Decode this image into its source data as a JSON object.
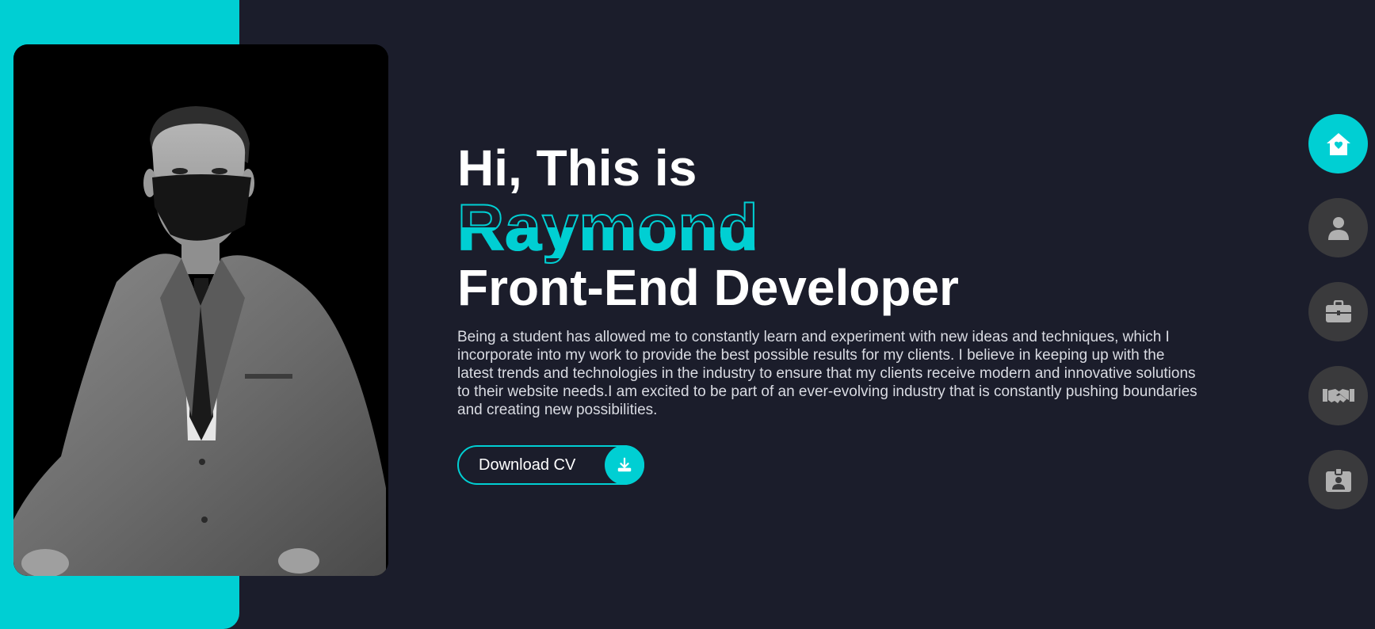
{
  "hero": {
    "greeting": "Hi, This is",
    "name": "Raymond",
    "role": "Front-End Developer",
    "bio": "Being a student has allowed me to constantly learn and experiment with new ideas and techniques, which I incorporate into my work to provide the best possible results for my clients. I believe in keeping up with the latest trends and technologies in the industry to ensure that my clients receive modern and innovative solutions to their website needs.I am excited to be part of an ever-evolving industry that is constantly pushing boundaries and creating new possibilities."
  },
  "cv_button": {
    "label": "Download CV",
    "icon": "download-icon"
  },
  "side_nav": {
    "items": [
      {
        "icon": "home-icon",
        "active": true
      },
      {
        "icon": "user-icon",
        "active": false
      },
      {
        "icon": "briefcase-icon",
        "active": false
      },
      {
        "icon": "handshake-icon",
        "active": false
      },
      {
        "icon": "contact-card-icon",
        "active": false
      }
    ]
  },
  "colors": {
    "accent": "#00cfd3",
    "background": "#1b1d2b",
    "nav_inactive": "#3a3a3c",
    "text": "#ffffff"
  }
}
